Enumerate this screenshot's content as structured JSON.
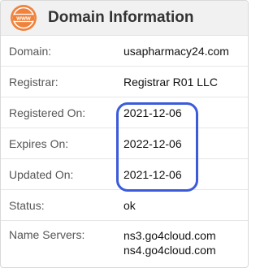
{
  "header": {
    "icon_name": "www-globe-icon",
    "icon_text": "www",
    "accent_color": "#f0823c",
    "title": "Domain Information"
  },
  "rows": [
    {
      "label": "Domain:",
      "value": "usapharmacy24.com"
    },
    {
      "label": "Registrar:",
      "value": "Registrar R01 LLC"
    },
    {
      "label": "Registered On:",
      "value": "2021-12-06"
    },
    {
      "label": "Expires On:",
      "value": "2022-12-06"
    },
    {
      "label": "Updated On:",
      "value": "2021-12-06"
    },
    {
      "label": "Status:",
      "value": "ok"
    }
  ],
  "name_servers": {
    "label": "Name Servers:",
    "values": [
      "ns3.go4cloud.com",
      "ns4.go4cloud.com"
    ]
  },
  "highlight_color": "#3b5bdb"
}
